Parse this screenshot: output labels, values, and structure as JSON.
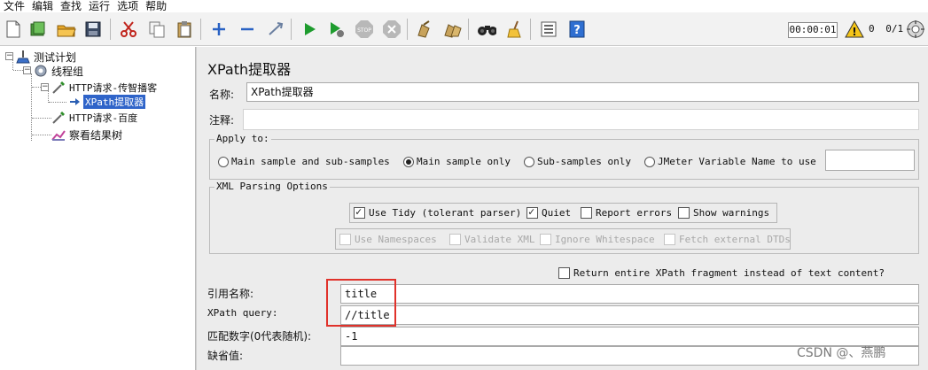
{
  "menu": [
    "文件",
    "编辑",
    "查找",
    "运行",
    "选项",
    "帮助"
  ],
  "toolbar": {
    "icons": [
      "new-file-icon",
      "templates-icon",
      "open-icon",
      "save-icon",
      "cut-icon",
      "copy-icon",
      "paste-icon",
      "expand-plus-icon",
      "collapse-minus-icon",
      "toggle-icon",
      "start-icon",
      "start-no-pause-icon",
      "stop-icon",
      "shutdown-icon",
      "clear-icon",
      "clear-all-icon",
      "search-binoculars-icon",
      "reset-search-broom-icon",
      "function-helper-icon",
      "help-icon"
    ],
    "timer": "00:00:01",
    "warning_count": "0",
    "threads": "0/1",
    "warning_icon": "warning-triangle-icon",
    "remote_icon": "remote-start-icon"
  },
  "tree": {
    "plan": "测试计划",
    "thread_group": "线程组",
    "http1": "HTTP请求-传智播客",
    "xpath": "XPath提取器",
    "http2": "HTTP请求-百度",
    "listener": "察看结果树",
    "expander_minus": "−"
  },
  "panel": {
    "title": "XPath提取器",
    "name_label": "名称:",
    "name_value": "XPath提取器",
    "comment_label": "注释:",
    "comment_value": ""
  },
  "apply_to": {
    "legend": "Apply to:",
    "options": [
      "Main sample and sub-samples",
      "Main sample only",
      "Sub-samples only",
      "JMeter Variable Name to use"
    ],
    "selected": 1,
    "variable_name": ""
  },
  "xml_options": {
    "legend": "XML Parsing Options",
    "row1": [
      {
        "label": "Use Tidy (tolerant parser)",
        "checked": true
      },
      {
        "label": "Quiet",
        "checked": true
      },
      {
        "label": "Report errors",
        "checked": false
      },
      {
        "label": "Show warnings",
        "checked": false
      }
    ],
    "row2": [
      {
        "label": "Use Namespaces",
        "checked": false
      },
      {
        "label": "Validate XML",
        "checked": false
      },
      {
        "label": "Ignore Whitespace",
        "checked": false
      },
      {
        "label": "Fetch external DTDs",
        "checked": false
      }
    ]
  },
  "return_fragment": {
    "label": "Return entire XPath fragment instead of text content?",
    "checked": false
  },
  "fields": {
    "ref_name_label": "引用名称:",
    "ref_name_value": "title",
    "query_label": "XPath query:",
    "query_value": "//title",
    "match_label": "匹配数字(0代表随机):",
    "match_value": "-1",
    "default_label": "缺省值:",
    "default_value": ""
  },
  "colors": {
    "highlight_box": "#e0322b",
    "selection": "#2f64c9"
  },
  "watermark": "CSDN @、燕鹏"
}
